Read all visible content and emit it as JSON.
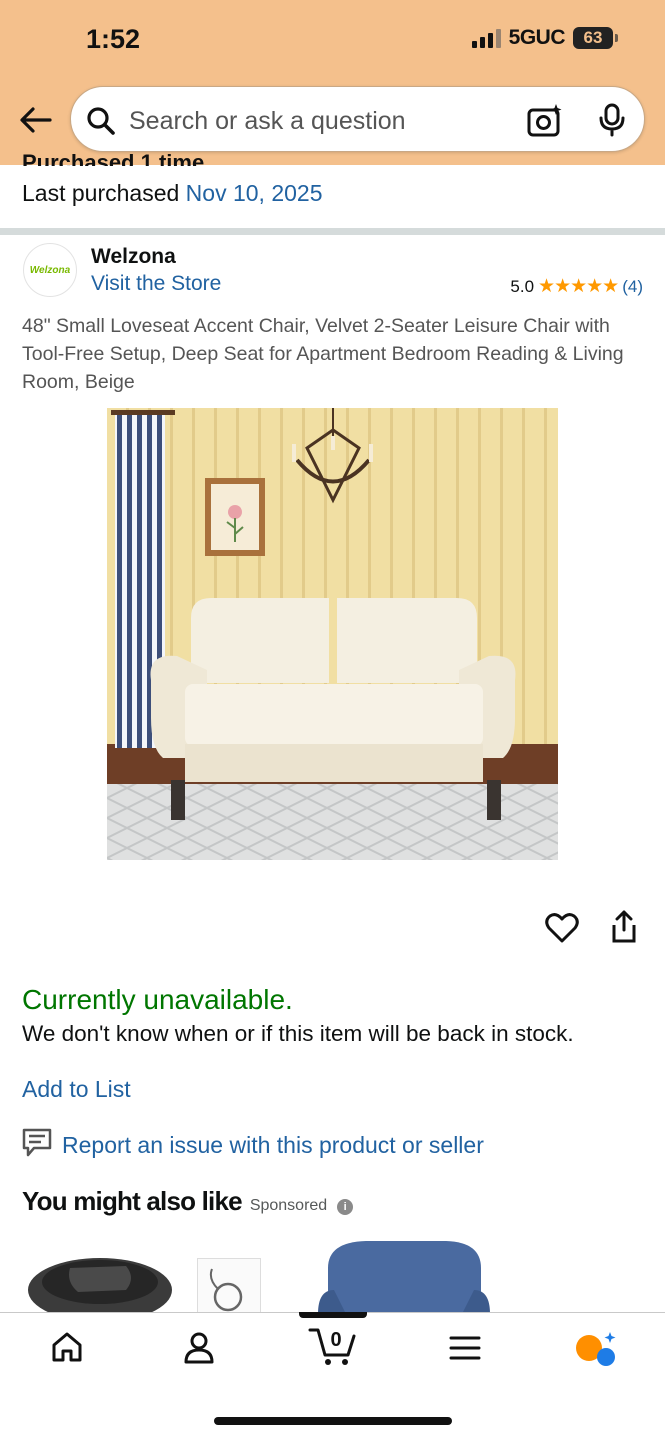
{
  "status_bar": {
    "time": "1:52",
    "network": "5GUC",
    "battery": "63"
  },
  "search": {
    "placeholder": "Search or ask a question"
  },
  "purchase": {
    "partial_text": "Purchased 1 time",
    "last_label": "Last purchased",
    "last_date": "Nov 10, 2025"
  },
  "brand": {
    "logo_text": "Welzona",
    "name": "Welzona",
    "store_link": "Visit the Store"
  },
  "rating": {
    "value": "5.0",
    "stars": "★★★★★",
    "count": "(4)"
  },
  "product": {
    "title": "48\" Small Loveseat Accent Chair, Velvet 2-Seater Leisure Chair with Tool-Free Setup, Deep Seat for Apartment Bedroom Reading & Living Room, Beige"
  },
  "availability": {
    "status": "Currently unavailable.",
    "note": "We don't know when or if this item will be back in stock."
  },
  "actions": {
    "add_to_list": "Add to List",
    "report": "Report an issue with this product or seller"
  },
  "recommendations": {
    "title": "You might also like",
    "sponsored": "Sponsored",
    "info": "i"
  },
  "bottom_nav": {
    "cart_count": "0"
  },
  "colors": {
    "header": "#f4c08c",
    "link": "#2162a1",
    "available": "#007600",
    "star": "#ff9900"
  }
}
